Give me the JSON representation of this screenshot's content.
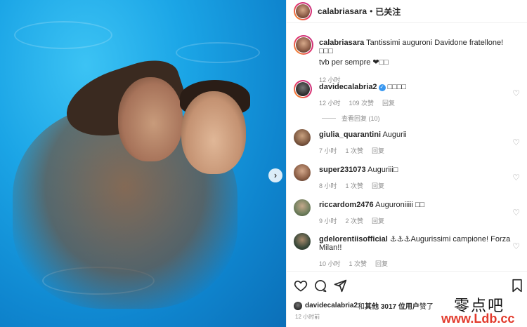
{
  "post_author": {
    "username": "calabriasara",
    "dot": "•",
    "follow_label": "已关注"
  },
  "caption": {
    "username": "calabriasara",
    "text": "Tantissimi auguroni Davidone fratellone! ",
    "emoji1": "□□□",
    "line2": "tvb per sempre ",
    "heart": "❤",
    "emoji2": "□□",
    "time": "12 小时"
  },
  "comments": [
    {
      "username": "davidecalabria2",
      "verified": true,
      "text": "□□□□",
      "time": "12 小时",
      "likes": "109 次赞",
      "reply": "回复",
      "view_replies": "查看回复 (10)"
    },
    {
      "username": "giulia_quarantini",
      "text": "Augurii",
      "time": "7 小时",
      "likes": "1 次赞",
      "reply": "回复"
    },
    {
      "username": "super231073",
      "text": "Auguriii□",
      "time": "8 小时",
      "likes": "1 次赞",
      "reply": "回复"
    },
    {
      "username": "riccardom2476",
      "text": "Auguroniiiii □□",
      "time": "9 小时",
      "likes": "2 次赞",
      "reply": "回复"
    },
    {
      "username": "gdelorentiisofficial",
      "text": "⚓⚓⚓Augurissimi campione! Forza Milan!!",
      "time": "10 小时",
      "likes": "1 次赞",
      "reply": "回复"
    }
  ],
  "likes": {
    "username": "davidecalabria2",
    "text_and": " 和 ",
    "text_others": "其他 3017 位用户",
    "text_liked": " 赞了"
  },
  "footer_time": "12 小时前",
  "watermark": {
    "cn": "零点吧",
    "url": "www.Ldb.cc"
  },
  "icons": [
    "heart-icon",
    "comment-icon",
    "share-icon",
    "bookmark-icon",
    "next-arrow-icon",
    "verified-icon"
  ],
  "colors": {
    "verified": "#3897f0",
    "watermark_url": "#e23a2c",
    "meta": "#8e8e8e"
  }
}
